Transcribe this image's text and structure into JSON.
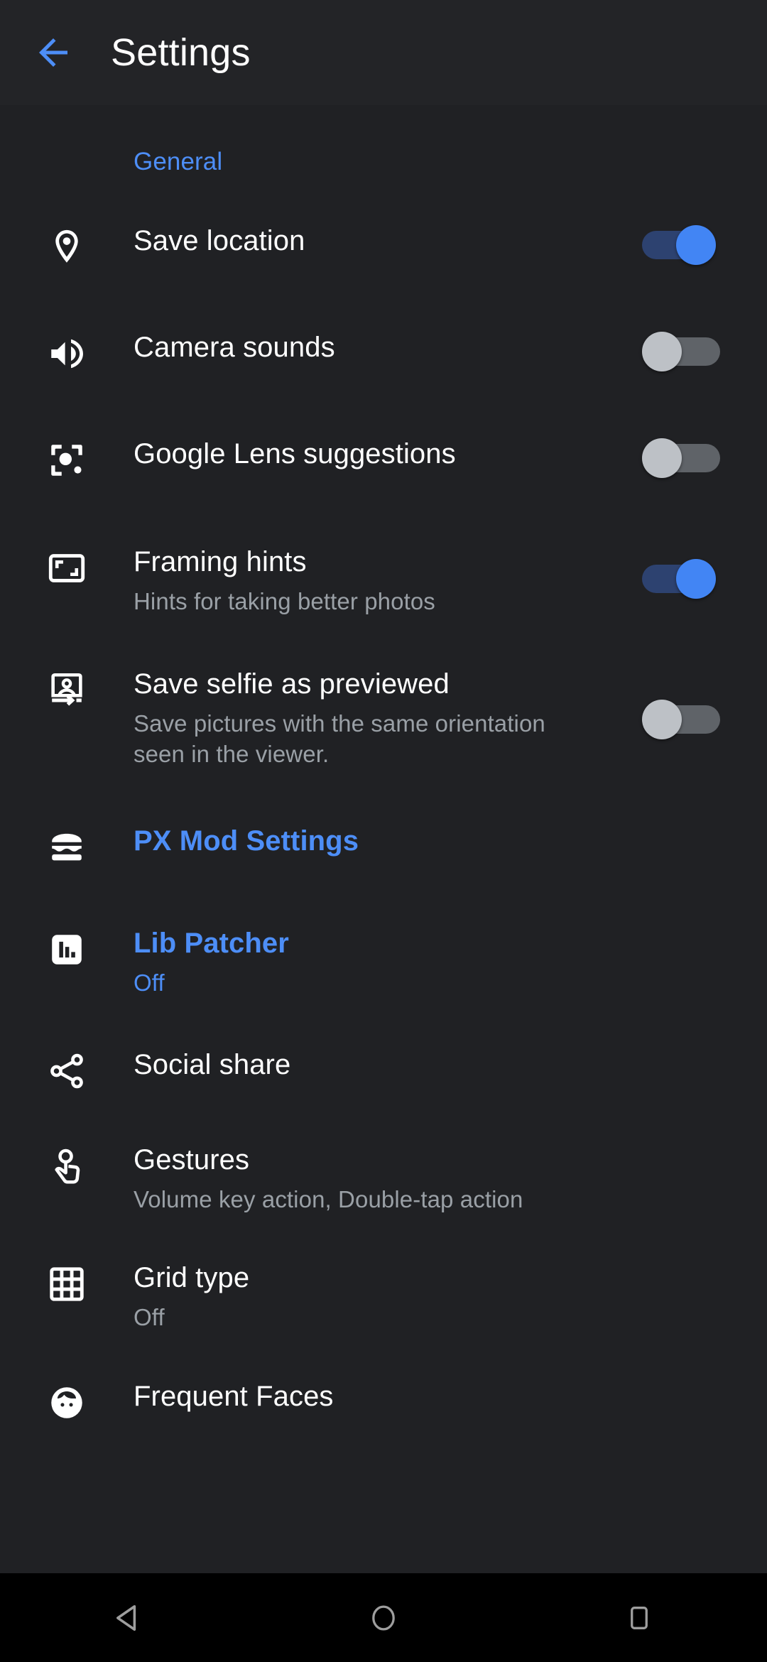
{
  "appbar": {
    "back_icon": "arrow-left-icon",
    "title": "Settings",
    "accent_color": "#4d8ef7"
  },
  "section": {
    "label": "General"
  },
  "settings_items": [
    {
      "icon": "location-pin-icon",
      "title": "Save location",
      "subtitle": "",
      "control": "toggle",
      "toggle_state": "on"
    },
    {
      "icon": "volume-up-icon",
      "title": "Camera sounds",
      "subtitle": "",
      "control": "toggle",
      "toggle_state": "off"
    },
    {
      "icon": "google-lens-icon",
      "title": "Google Lens suggestions",
      "subtitle": "",
      "control": "toggle",
      "toggle_state": "off"
    },
    {
      "icon": "framing-hints-icon",
      "title": "Framing hints",
      "subtitle": "Hints for taking better photos",
      "control": "toggle",
      "toggle_state": "on"
    },
    {
      "icon": "flip-selfie-icon",
      "title": "Save selfie as previewed",
      "subtitle": "Save pictures with the same orientation seen in the viewer.",
      "control": "toggle",
      "toggle_state": "off"
    },
    {
      "icon": "burger-menu-icon",
      "title": "PX Mod Settings",
      "subtitle": "",
      "control": "none",
      "accent": true
    },
    {
      "icon": "bar-chart-icon",
      "title": "Lib Patcher",
      "subtitle": "Off",
      "control": "none",
      "accent": true
    },
    {
      "icon": "share-icon",
      "title": "Social share",
      "subtitle": "",
      "control": "none"
    },
    {
      "icon": "touch-gesture-icon",
      "title": "Gestures",
      "subtitle": "Volume key action, Double-tap action",
      "control": "none"
    },
    {
      "icon": "grid-icon",
      "title": "Grid type",
      "subtitle": "Off",
      "control": "none"
    },
    {
      "icon": "face-icon",
      "title": "Frequent Faces",
      "subtitle": "",
      "control": "none"
    }
  ],
  "navbar": {
    "back_label": "back-triangle-icon",
    "home_label": "home-circle-icon",
    "recents_label": "recents-square-icon"
  }
}
